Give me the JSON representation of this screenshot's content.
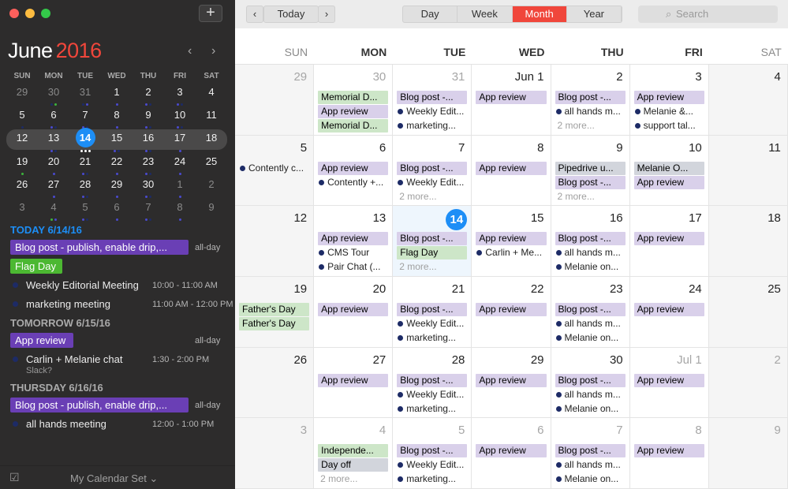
{
  "sidebar": {
    "mini": {
      "month": "June",
      "year": "2016",
      "weekdays": [
        "SUN",
        "MON",
        "TUE",
        "WED",
        "THU",
        "FRI",
        "SAT"
      ],
      "weeks": [
        [
          {
            "d": "29",
            "o": 1,
            "dots": []
          },
          {
            "d": "30",
            "o": 1,
            "dots": [
              "#1d2b66",
              "#3cb43c"
            ]
          },
          {
            "d": "31",
            "o": 1,
            "dots": [
              "#1d2b66",
              "#4a4ad0"
            ]
          },
          {
            "d": "1",
            "o": 0,
            "dots": [
              "#4a4ad0"
            ]
          },
          {
            "d": "2",
            "o": 0,
            "dots": [
              "#4a4ad0",
              "#1d2b66"
            ]
          },
          {
            "d": "3",
            "o": 0,
            "dots": [
              "#4a4ad0",
              "#1d2b66"
            ]
          },
          {
            "d": "4",
            "o": 0,
            "dots": []
          }
        ],
        [
          {
            "d": "5",
            "o": 0,
            "dots": [
              "#1d2b66"
            ]
          },
          {
            "d": "6",
            "o": 0,
            "dots": [
              "#4a4ad0",
              "#1d2b66"
            ]
          },
          {
            "d": "7",
            "o": 0,
            "dots": [
              "#4a4ad0",
              "#1d2b66"
            ]
          },
          {
            "d": "8",
            "o": 0,
            "dots": [
              "#4a4ad0"
            ]
          },
          {
            "d": "9",
            "o": 0,
            "dots": [
              "#4a4ad0",
              "#1d2b66"
            ]
          },
          {
            "d": "10",
            "o": 0,
            "dots": [
              "#4a4ad0",
              "#1d2b66"
            ]
          },
          {
            "d": "11",
            "o": 0,
            "dots": []
          }
        ],
        [
          {
            "d": "12",
            "o": 0,
            "dots": []
          },
          {
            "d": "13",
            "o": 0,
            "dots": [
              "#4a4ad0",
              "#1d2b66"
            ]
          },
          {
            "d": "14",
            "o": 0,
            "t": 1,
            "dots": [
              "#ffffff",
              "#ffffff",
              "#ffffff"
            ]
          },
          {
            "d": "15",
            "o": 0,
            "dots": [
              "#4a4ad0",
              "#1d2b66"
            ]
          },
          {
            "d": "16",
            "o": 0,
            "dots": [
              "#4a4ad0",
              "#1d2b66"
            ]
          },
          {
            "d": "17",
            "o": 0,
            "dots": [
              "#4a4ad0"
            ]
          },
          {
            "d": "18",
            "o": 0,
            "dots": []
          }
        ],
        [
          {
            "d": "19",
            "o": 0,
            "dots": [
              "#3cb43c"
            ]
          },
          {
            "d": "20",
            "o": 0,
            "dots": [
              "#4a4ad0"
            ]
          },
          {
            "d": "21",
            "o": 0,
            "dots": [
              "#4a4ad0",
              "#1d2b66"
            ]
          },
          {
            "d": "22",
            "o": 0,
            "dots": [
              "#4a4ad0"
            ]
          },
          {
            "d": "23",
            "o": 0,
            "dots": [
              "#4a4ad0",
              "#1d2b66"
            ]
          },
          {
            "d": "24",
            "o": 0,
            "dots": [
              "#4a4ad0"
            ]
          },
          {
            "d": "25",
            "o": 0,
            "dots": []
          }
        ],
        [
          {
            "d": "26",
            "o": 0,
            "dots": []
          },
          {
            "d": "27",
            "o": 0,
            "dots": [
              "#4a4ad0"
            ]
          },
          {
            "d": "28",
            "o": 0,
            "dots": [
              "#4a4ad0",
              "#1d2b66"
            ]
          },
          {
            "d": "29",
            "o": 0,
            "dots": [
              "#4a4ad0"
            ]
          },
          {
            "d": "30",
            "o": 0,
            "dots": [
              "#4a4ad0",
              "#1d2b66"
            ]
          },
          {
            "d": "1",
            "o": 1,
            "dots": [
              "#4a4ad0"
            ]
          },
          {
            "d": "2",
            "o": 1,
            "dots": []
          }
        ],
        [
          {
            "d": "3",
            "o": 1,
            "dots": []
          },
          {
            "d": "4",
            "o": 1,
            "dots": [
              "#3cb43c",
              "#4a4ad0"
            ]
          },
          {
            "d": "5",
            "o": 1,
            "dots": [
              "#4a4ad0",
              "#1d2b66"
            ]
          },
          {
            "d": "6",
            "o": 1,
            "dots": [
              "#4a4ad0"
            ]
          },
          {
            "d": "7",
            "o": 1,
            "dots": [
              "#4a4ad0",
              "#1d2b66"
            ]
          },
          {
            "d": "8",
            "o": 1,
            "dots": [
              "#4a4ad0"
            ]
          },
          {
            "d": "9",
            "o": 1,
            "dots": []
          }
        ]
      ]
    },
    "agenda": [
      {
        "header": "TODAY 6/14/16",
        "today": true,
        "items": [
          {
            "kind": "pill",
            "title": "Blog post - publish, enable drip,...",
            "color": "#6a3fb5",
            "width": 226,
            "allday": "all-day"
          },
          {
            "kind": "pill",
            "title": "Flag Day",
            "color": "#4cb832",
            "width": 66
          },
          {
            "kind": "dot",
            "title": "Weekly Editorial Meeting",
            "time": "10:00 - 11:00 AM"
          },
          {
            "kind": "dot",
            "title": "marketing meeting",
            "time": "11:00 AM - 12:00 PM"
          }
        ]
      },
      {
        "header": "TOMORROW 6/15/16",
        "items": [
          {
            "kind": "pill",
            "title": "App review",
            "color": "#6a3fb5",
            "width": 80,
            "allday": "all-day"
          },
          {
            "kind": "dot",
            "title": "Carlin + Melanie chat",
            "time": "1:30 - 2:00 PM",
            "sub": "Slack?"
          }
        ]
      },
      {
        "header": "THURSDAY 6/16/16",
        "items": [
          {
            "kind": "pill",
            "title": "Blog post - publish, enable drip,...",
            "color": "#6a3fb5",
            "width": 226,
            "allday": "all-day"
          },
          {
            "kind": "dot",
            "title": "all hands meeting",
            "time": "12:00 - 1:00 PM"
          }
        ]
      }
    ],
    "footer": {
      "set": "My Calendar Set ⌄"
    }
  },
  "toolbar": {
    "today": "Today",
    "views": [
      "Day",
      "Week",
      "Month",
      "Year"
    ],
    "active_view": "Month",
    "search_placeholder": "Search"
  },
  "day_headers": [
    "SUN",
    "MON",
    "TUE",
    "WED",
    "THU",
    "FRI",
    "SAT"
  ],
  "weeks": [
    [
      {
        "n": "29",
        "dim": 1
      },
      {
        "n": "30",
        "dim": 1,
        "ev": [
          [
            "bar",
            "Memorial D...",
            "#cde6c8"
          ],
          [
            "bar",
            "App review",
            "#d9d0ea"
          ],
          [
            "bar",
            "Memorial D...",
            "#cde6c8"
          ]
        ]
      },
      {
        "n": "31",
        "dim": 1,
        "ev": [
          [
            "bar",
            "Blog post -...",
            "#d9d0ea"
          ],
          [
            "dot",
            "Weekly Edit..."
          ],
          [
            "dot",
            "marketing..."
          ]
        ]
      },
      {
        "n": "Jun 1",
        "ev": [
          [
            "bar",
            "App review",
            "#d9d0ea"
          ]
        ]
      },
      {
        "n": "2",
        "ev": [
          [
            "bar",
            "Blog post -...",
            "#d9d0ea"
          ],
          [
            "dot",
            "all hands m..."
          ],
          [
            "more",
            "2 more..."
          ]
        ]
      },
      {
        "n": "3",
        "ev": [
          [
            "bar",
            "App review",
            "#d9d0ea"
          ],
          [
            "dot",
            "Melanie &..."
          ],
          [
            "dot",
            "support tal..."
          ]
        ]
      },
      {
        "n": "4"
      }
    ],
    [
      {
        "n": "5",
        "ev": [
          [
            "dot",
            "Contently c..."
          ]
        ]
      },
      {
        "n": "6",
        "ev": [
          [
            "bar",
            "App review",
            "#d9d0ea"
          ],
          [
            "dot",
            "Contently +..."
          ]
        ]
      },
      {
        "n": "7",
        "ev": [
          [
            "bar",
            "Blog post -...",
            "#d9d0ea"
          ],
          [
            "dot",
            "Weekly Edit..."
          ],
          [
            "more",
            "2 more..."
          ]
        ]
      },
      {
        "n": "8",
        "ev": [
          [
            "bar",
            "App review",
            "#d9d0ea"
          ]
        ]
      },
      {
        "n": "9",
        "ev": [
          [
            "bar",
            "Pipedrive u...",
            "#d2d5dc"
          ],
          [
            "bar",
            "Blog post -...",
            "#d9d0ea"
          ],
          [
            "more",
            "2 more..."
          ]
        ]
      },
      {
        "n": "10",
        "ev": [
          [
            "bar",
            "Melanie O...",
            "#d2d5dc"
          ],
          [
            "bar",
            "App review",
            "#d9d0ea"
          ]
        ]
      },
      {
        "n": "11"
      }
    ],
    [
      {
        "n": "12"
      },
      {
        "n": "13",
        "ev": [
          [
            "bar",
            "App review",
            "#d9d0ea"
          ],
          [
            "dot",
            "CMS Tour"
          ],
          [
            "dot",
            "Pair Chat (..."
          ]
        ]
      },
      {
        "n": "14",
        "today": 1,
        "ev": [
          [
            "bar",
            "Blog post -...",
            "#d9d0ea"
          ],
          [
            "bar",
            "Flag Day",
            "#cde6c8"
          ],
          [
            "more",
            "2 more..."
          ]
        ]
      },
      {
        "n": "15",
        "ev": [
          [
            "bar",
            "App review",
            "#d9d0ea"
          ],
          [
            "dot",
            "Carlin + Me..."
          ]
        ]
      },
      {
        "n": "16",
        "ev": [
          [
            "bar",
            "Blog post -...",
            "#d9d0ea"
          ],
          [
            "dot",
            "all hands m..."
          ],
          [
            "dot",
            "Melanie on..."
          ]
        ]
      },
      {
        "n": "17",
        "ev": [
          [
            "bar",
            "App review",
            "#d9d0ea"
          ]
        ]
      },
      {
        "n": "18"
      }
    ],
    [
      {
        "n": "19",
        "ev": [
          [
            "bar",
            "Father's Day",
            "#cde6c8"
          ],
          [
            "bar",
            "Father's Day",
            "#cde6c8"
          ]
        ]
      },
      {
        "n": "20",
        "ev": [
          [
            "bar",
            "App review",
            "#d9d0ea"
          ]
        ]
      },
      {
        "n": "21",
        "ev": [
          [
            "bar",
            "Blog post -...",
            "#d9d0ea"
          ],
          [
            "dot",
            "Weekly Edit..."
          ],
          [
            "dot",
            "marketing..."
          ]
        ]
      },
      {
        "n": "22",
        "ev": [
          [
            "bar",
            "App review",
            "#d9d0ea"
          ]
        ]
      },
      {
        "n": "23",
        "ev": [
          [
            "bar",
            "Blog post -...",
            "#d9d0ea"
          ],
          [
            "dot",
            "all hands m..."
          ],
          [
            "dot",
            "Melanie on..."
          ]
        ]
      },
      {
        "n": "24",
        "ev": [
          [
            "bar",
            "App review",
            "#d9d0ea"
          ]
        ]
      },
      {
        "n": "25"
      }
    ],
    [
      {
        "n": "26"
      },
      {
        "n": "27",
        "ev": [
          [
            "bar",
            "App review",
            "#d9d0ea"
          ]
        ]
      },
      {
        "n": "28",
        "ev": [
          [
            "bar",
            "Blog post -...",
            "#d9d0ea"
          ],
          [
            "dot",
            "Weekly Edit..."
          ],
          [
            "dot",
            "marketing..."
          ]
        ]
      },
      {
        "n": "29",
        "ev": [
          [
            "bar",
            "App review",
            "#d9d0ea"
          ]
        ]
      },
      {
        "n": "30",
        "ev": [
          [
            "bar",
            "Blog post -...",
            "#d9d0ea"
          ],
          [
            "dot",
            "all hands m..."
          ],
          [
            "dot",
            "Melanie on..."
          ]
        ]
      },
      {
        "n": "Jul 1",
        "dim": 1,
        "ev": [
          [
            "bar",
            "App review",
            "#d9d0ea"
          ]
        ]
      },
      {
        "n": "2",
        "dim": 1
      }
    ],
    [
      {
        "n": "3",
        "dim": 1
      },
      {
        "n": "4",
        "dim": 1,
        "ev": [
          [
            "bar",
            "Independe...",
            "#cde6c8"
          ],
          [
            "bar",
            "Day off",
            "#d2d5dc"
          ],
          [
            "more",
            "2 more..."
          ]
        ]
      },
      {
        "n": "5",
        "dim": 1,
        "ev": [
          [
            "bar",
            "Blog post -...",
            "#d9d0ea"
          ],
          [
            "dot",
            "Weekly Edit..."
          ],
          [
            "dot",
            "marketing..."
          ]
        ]
      },
      {
        "n": "6",
        "dim": 1,
        "ev": [
          [
            "bar",
            "App review",
            "#d9d0ea"
          ]
        ]
      },
      {
        "n": "7",
        "dim": 1,
        "ev": [
          [
            "bar",
            "Blog post -...",
            "#d9d0ea"
          ],
          [
            "dot",
            "all hands m..."
          ],
          [
            "dot",
            "Melanie on..."
          ]
        ]
      },
      {
        "n": "8",
        "dim": 1,
        "ev": [
          [
            "bar",
            "App review",
            "#d9d0ea"
          ]
        ]
      },
      {
        "n": "9",
        "dim": 1
      }
    ]
  ]
}
